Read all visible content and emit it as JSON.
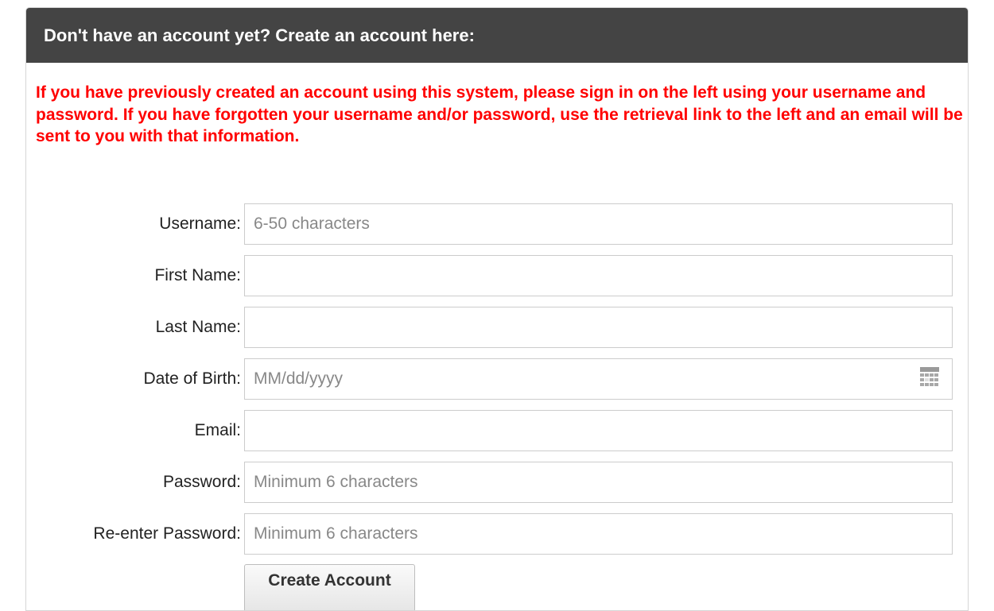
{
  "header": {
    "title": "Don't have an account yet? Create an account here:"
  },
  "notice": {
    "text": "If you have previously created an account using this system, please sign in on the left using your username and password. If you have forgotten your username and/or password, use the retrieval link to the left and an email will be sent to you with that information."
  },
  "form": {
    "username": {
      "label": "Username:",
      "value": "",
      "placeholder": "6-50 characters"
    },
    "first_name": {
      "label": "First Name:",
      "value": "",
      "placeholder": ""
    },
    "last_name": {
      "label": "Last Name:",
      "value": "",
      "placeholder": ""
    },
    "dob": {
      "label": "Date of Birth:",
      "value": "",
      "placeholder": "MM/dd/yyyy",
      "icon": "calendar-icon"
    },
    "email": {
      "label": "Email:",
      "value": "",
      "placeholder": ""
    },
    "password": {
      "label": "Password:",
      "value": "",
      "placeholder": "Minimum 6 characters"
    },
    "reenter_password": {
      "label": "Re-enter Password:",
      "value": "",
      "placeholder": "Minimum 6 characters"
    },
    "submit_label": "Create Account"
  },
  "colors": {
    "header_bg": "#444444",
    "notice_text": "#ff0000"
  }
}
